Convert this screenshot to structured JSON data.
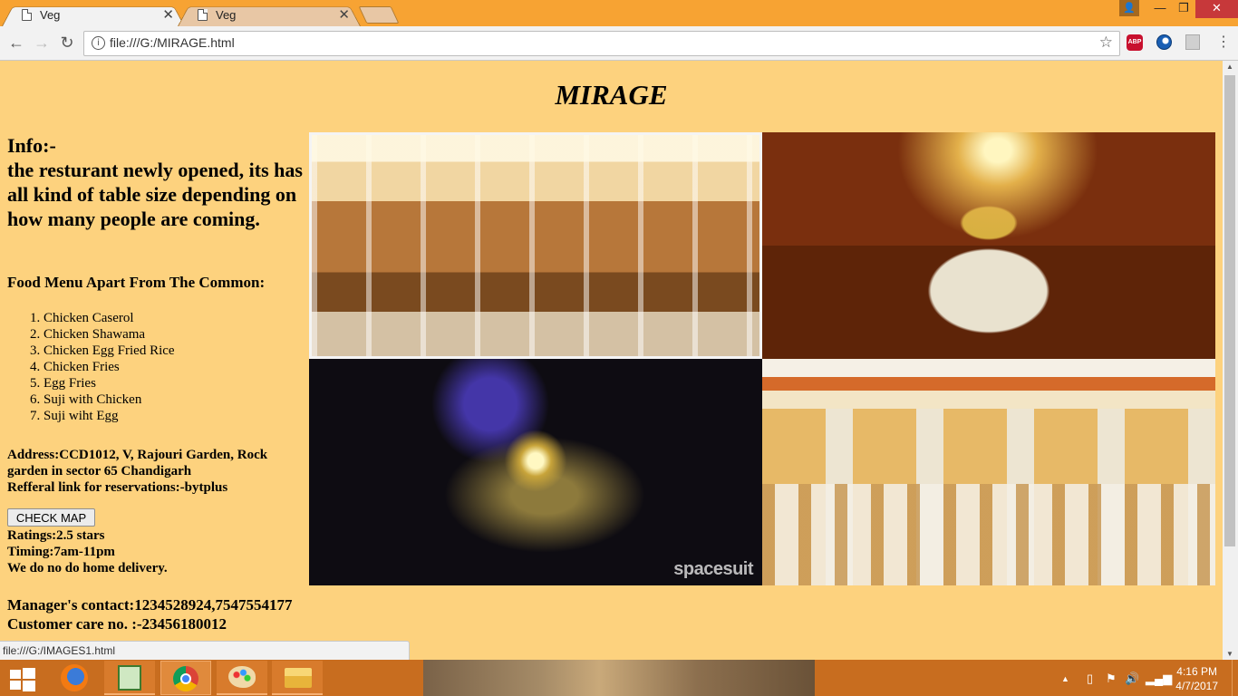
{
  "browser": {
    "tabs": [
      {
        "label": "Veg",
        "active": true
      },
      {
        "label": "Veg",
        "active": false
      }
    ],
    "url": "file:///G:/MIRAGE.html",
    "status_url": "file:///G:/IMAGES1.html",
    "extensions": {
      "abp": "ABP"
    }
  },
  "page": {
    "title": "MIRAGE",
    "info_heading": "Info:-",
    "info_text": "the resturant newly opened, its has all kind of table size depending on how many people are coming.",
    "menu_heading": "Food Menu Apart From The Common:",
    "menu_items": [
      "Chicken Caserol",
      "Chicken Shawama",
      "Chicken Egg Fried Rice",
      "Chicken Fries",
      "Egg Fries",
      "Suji with Chicken",
      "Suji wiht Egg"
    ],
    "address": "Address:CCD1012, V, Rajouri Garden, Rock garden in sector 65 Chandigarh",
    "referral": "Refferal link for reservations:-bytplus",
    "check_map_label": "CHECK MAP",
    "ratings": "Ratings:2.5 stars",
    "timing": "Timing:7am-11pm",
    "delivery": "We do no do home delivery.",
    "manager_contact": "Manager's contact:1234528924,7547554177",
    "customer_care": "Customer care no. :-23456180012",
    "photo_watermark": "spacesuit"
  },
  "taskbar": {
    "time": "4:16 PM",
    "date": "4/7/2017",
    "apps": [
      "firefox",
      "spreadsheet",
      "chrome",
      "paint",
      "file-explorer"
    ]
  },
  "colors": {
    "page_background": "#fdd27e",
    "titlebar": "#f7a333",
    "taskbar": "#c86d1f"
  }
}
